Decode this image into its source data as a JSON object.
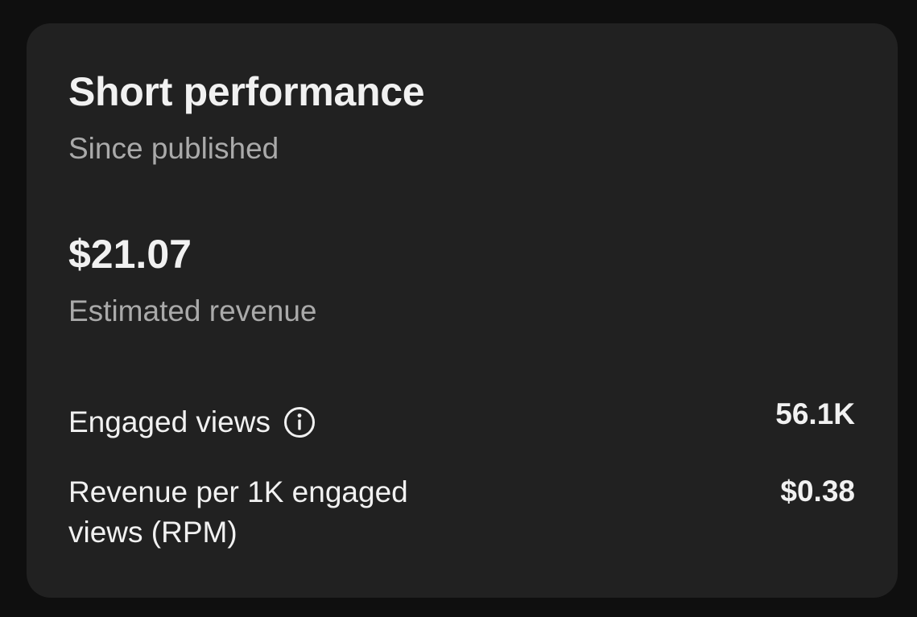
{
  "card": {
    "title": "Short performance",
    "subtitle": "Since published",
    "revenue": {
      "value": "$21.07",
      "label": "Estimated revenue"
    },
    "metrics": [
      {
        "label": "Engaged views",
        "value": "56.1K",
        "icon": "info-icon"
      },
      {
        "label": "Revenue per 1K engaged views (RPM)",
        "value": "$0.38"
      }
    ]
  },
  "colors": {
    "page_background": "#0f0f0f",
    "card_background": "#212121",
    "primary_text": "#f1f1f1",
    "secondary_text": "#aaaaaa"
  }
}
